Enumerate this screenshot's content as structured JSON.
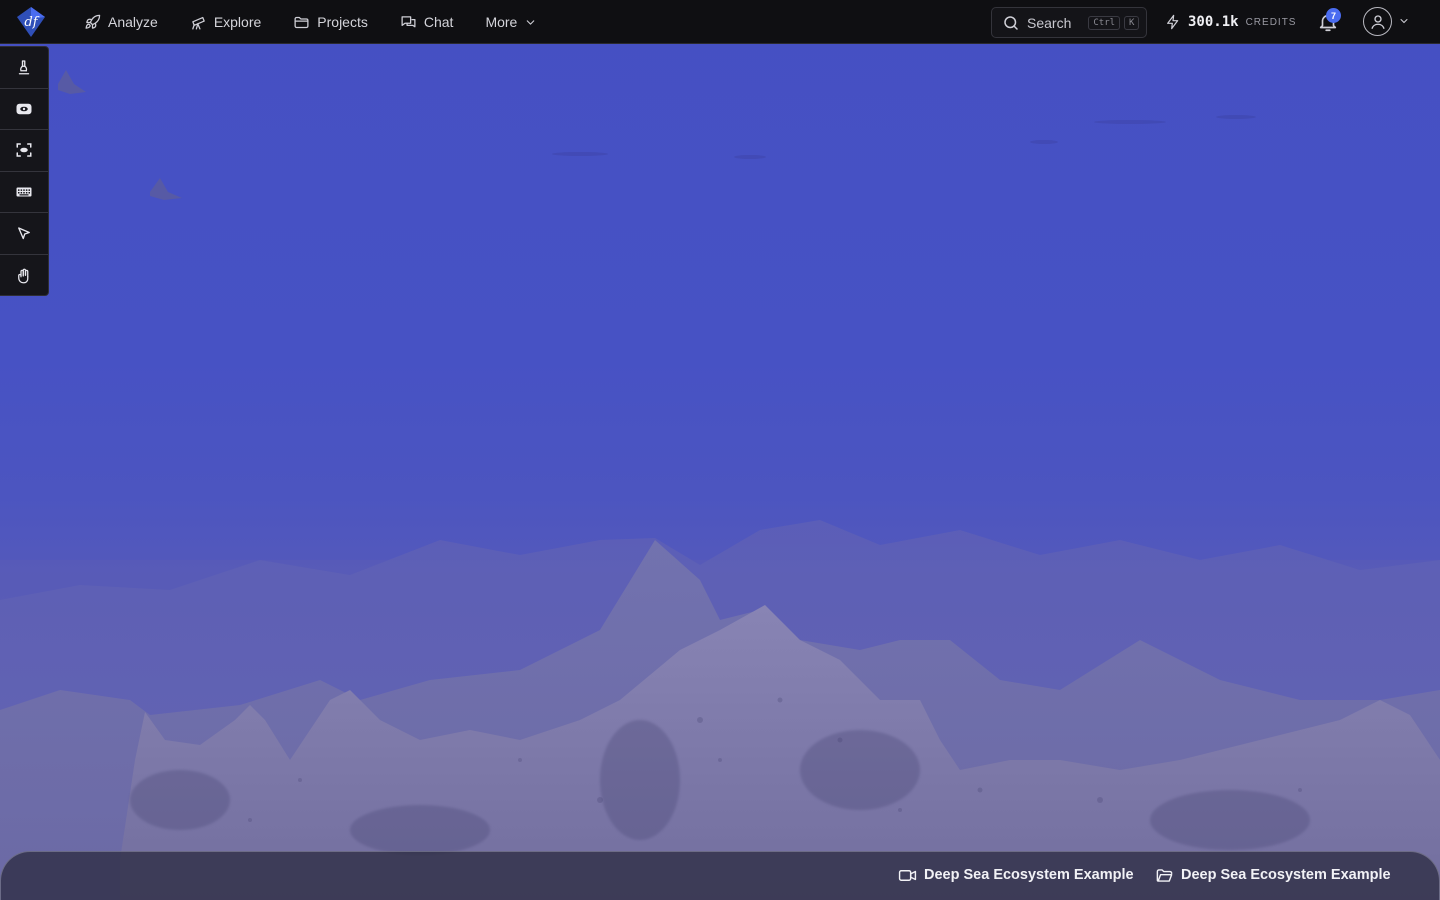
{
  "app": {
    "logo_text": "df"
  },
  "nav": {
    "items": [
      {
        "label": "Analyze",
        "icon": "rocket-icon"
      },
      {
        "label": "Explore",
        "icon": "telescope-icon"
      },
      {
        "label": "Projects",
        "icon": "folder-icon"
      },
      {
        "label": "Chat",
        "icon": "chat-icon"
      },
      {
        "label": "More",
        "icon": "chevron-down-icon"
      }
    ]
  },
  "search": {
    "label": "Search",
    "shortcut_keys": [
      "Ctrl",
      "K"
    ]
  },
  "credits": {
    "value": "300.1k",
    "label": "CREDITS"
  },
  "notifications": {
    "count": "7"
  },
  "toolbar": {
    "tools": [
      {
        "name": "microscope-tool"
      },
      {
        "name": "eye-tool"
      },
      {
        "name": "focus-tool"
      },
      {
        "name": "keyboard-tool"
      },
      {
        "name": "pointer-tool"
      },
      {
        "name": "hand-tool"
      }
    ]
  },
  "bottom": {
    "video_label": "Deep Sea Ecosystem Example",
    "project_label": "Deep Sea Ecosystem Example"
  },
  "colors": {
    "water": "#4650c2",
    "topbar": "#0f0f12",
    "accent": "#4a6cf0"
  }
}
